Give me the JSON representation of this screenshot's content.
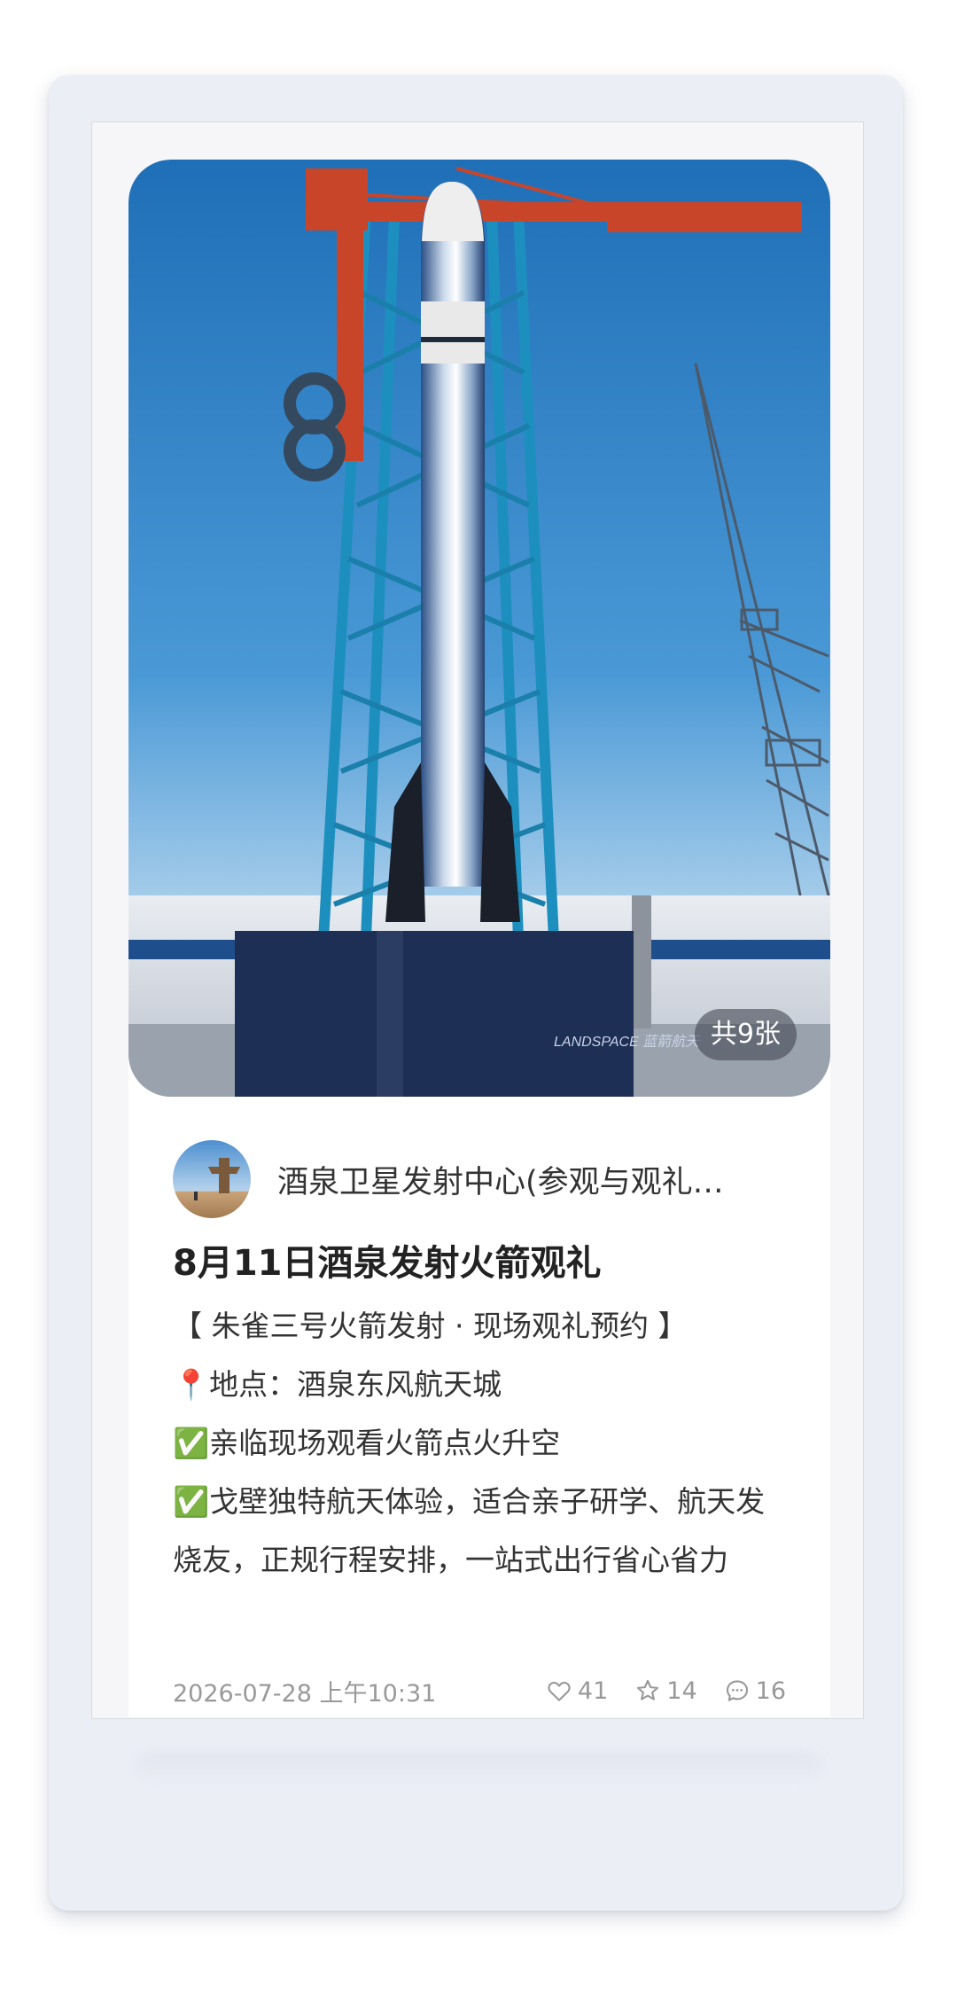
{
  "post": {
    "image_count_label": "共9张",
    "author_name": "酒泉卫星发射中心(参观与观礼…",
    "title": "8月11日酒泉发射火箭观礼",
    "body_lines": [
      "【 朱雀三号火箭发射 · 现场观礼预约 】",
      "📍地点：酒泉东风航天城",
      "✅亲临现场观看火箭点火升空",
      "✅戈壁独特航天体验，适合亲子研学、航天发烧友，正规行程安排，一站式出行省心省力"
    ],
    "timestamp": "2026-07-28 上午10:31",
    "likes": "41",
    "favorites": "14",
    "comments": "16",
    "photo_watermark": "LANDSPACE 蓝箭航天"
  },
  "icons": {
    "like": "heart-icon",
    "favorite": "star-icon",
    "comment": "comment-bubble-icon"
  },
  "colors": {
    "sky_top": "#1f6fb8",
    "tower": "#1d8fbf",
    "gantry": "#c8452a",
    "base": "#1e2f55"
  }
}
